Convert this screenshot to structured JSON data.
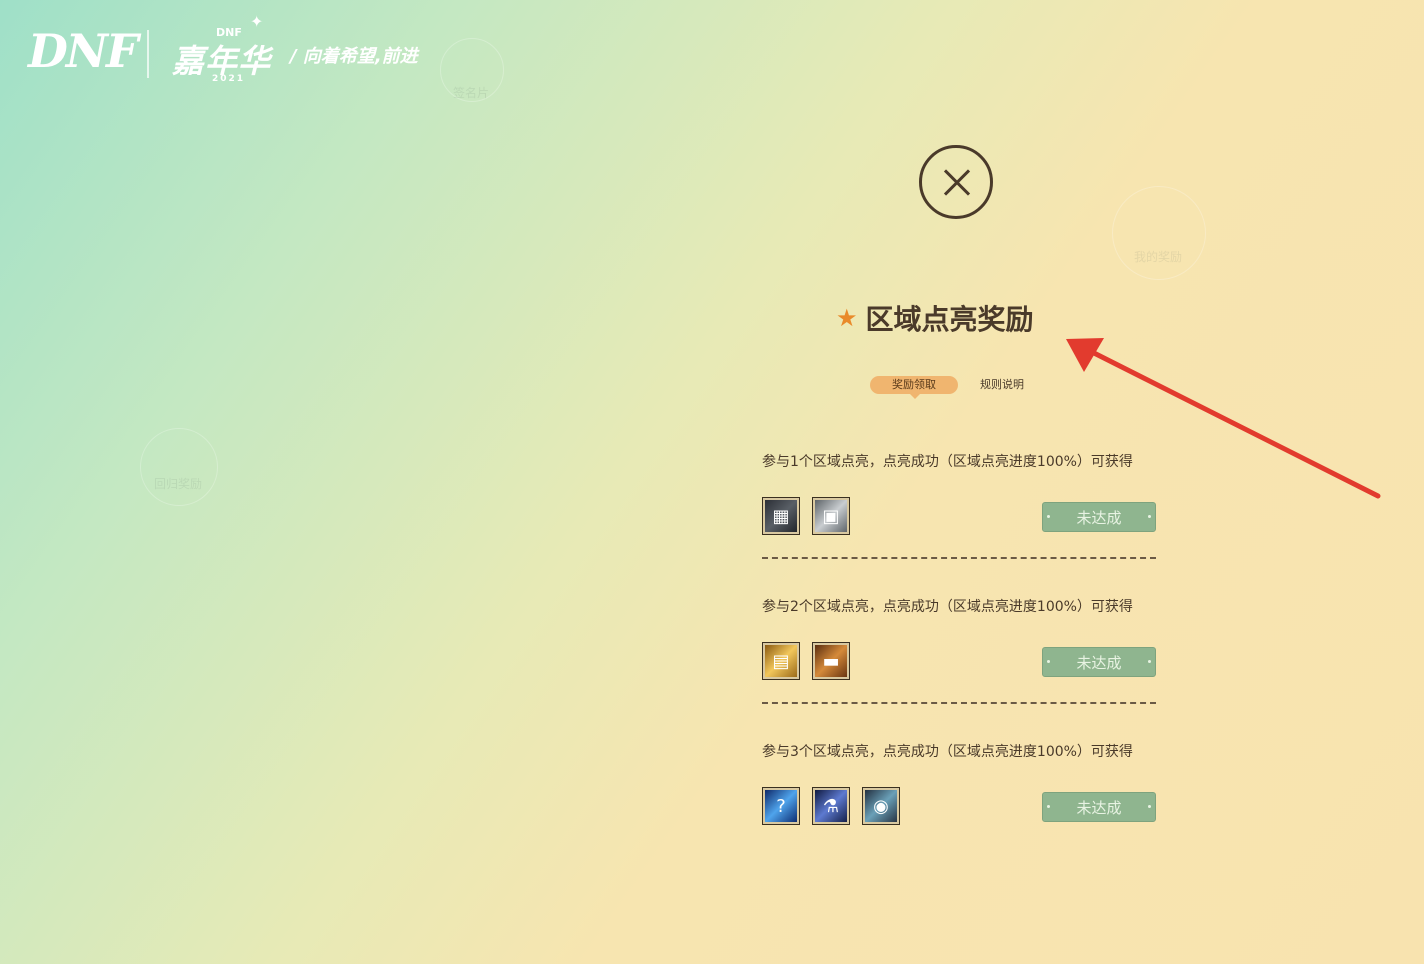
{
  "logo": {
    "brand": "DNF",
    "event_small": "DNF",
    "event": "嘉年华",
    "year": "2021",
    "slogan": "/ 向着希望,前进"
  },
  "ghost_labels": [
    "签名片",
    "我的奖励",
    "回归奖励"
  ],
  "modal": {
    "title": "区域点亮奖励",
    "tabs": [
      {
        "label": "奖励领取",
        "active": true
      },
      {
        "label": "规则说明",
        "active": false
      }
    ],
    "rewards": [
      {
        "condition": "参与1个区域点亮，点亮成功（区域点亮进度100%）可获得",
        "items": [
          {
            "icon": "dark-box-icon"
          },
          {
            "icon": "silver-box-icon"
          }
        ],
        "status": "未达成"
      },
      {
        "condition": "参与2个区域点亮，点亮成功（区域点亮进度100%）可获得",
        "items": [
          {
            "icon": "gold-box-icon"
          },
          {
            "icon": "treasure-chest-icon"
          }
        ],
        "status": "未达成"
      },
      {
        "condition": "参与3个区域点亮，点亮成功（区域点亮进度100%）可获得",
        "items": [
          {
            "icon": "blue-orb-icon"
          },
          {
            "icon": "blue-potion-icon"
          },
          {
            "icon": "pouch-icon"
          }
        ],
        "status": "未达成"
      }
    ]
  },
  "colors": {
    "accent": "#f0b56f",
    "button": "#8fb58f",
    "title": "#4a3a2a",
    "annotation_arrow": "#e23b2e"
  }
}
